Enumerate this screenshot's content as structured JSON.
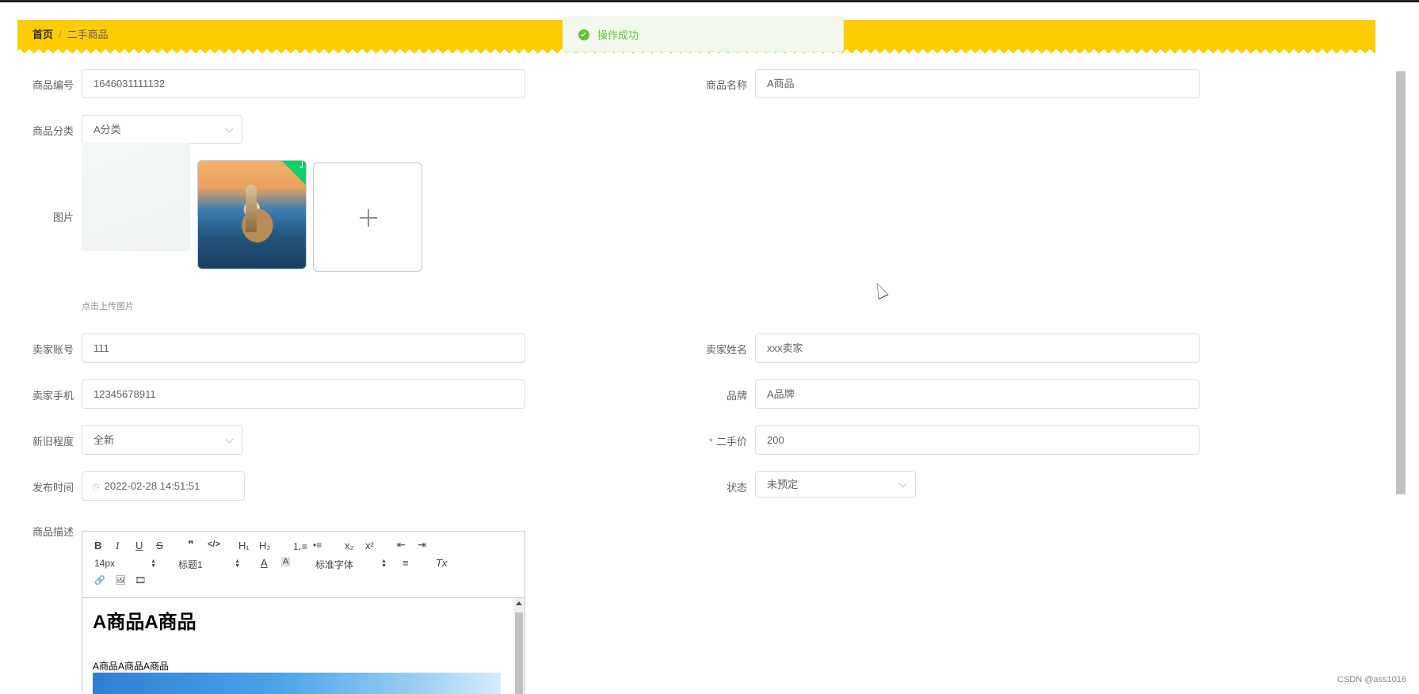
{
  "breadcrumb": {
    "home": "首页",
    "separator": "/",
    "current": "二手商品"
  },
  "toast": {
    "message": "操作成功"
  },
  "form": {
    "product_no": {
      "label": "商品编号",
      "value": "1646031111132"
    },
    "product_name": {
      "label": "商品名称",
      "value": "A商品"
    },
    "category": {
      "label": "商品分类",
      "value": "A分类"
    },
    "image": {
      "label": "图片",
      "hint": "点击上传图片"
    },
    "seller_account": {
      "label": "卖家账号",
      "value": "111"
    },
    "seller_name": {
      "label": "卖家姓名",
      "value": "xxx卖家"
    },
    "seller_phone": {
      "label": "卖家手机",
      "value": "12345678911"
    },
    "brand": {
      "label": "品牌",
      "value": "A品牌"
    },
    "condition": {
      "label": "新旧程度",
      "value": "全新"
    },
    "price": {
      "label": "二手价",
      "required_mark": "*",
      "value": "200"
    },
    "publish_time": {
      "label": "发布时间",
      "value": "2022-02-28 14:51:51"
    },
    "status": {
      "label": "状态",
      "value": "未预定"
    },
    "description": {
      "label": "商品描述"
    }
  },
  "editor": {
    "toolbar": {
      "bold": "B",
      "italic": "I",
      "underline": "U",
      "strike": "S",
      "quote": "❞",
      "code": "</>",
      "h1": "H₁",
      "h2": "H₂",
      "ordered_list": "⒈≡",
      "bullet_list": "•≡",
      "subscript": "x₂",
      "superscript": "x²",
      "outdent": "⇤",
      "indent": "⇥",
      "font_size": "14px",
      "header": "标题1",
      "text_color": "A",
      "bg_color": "A",
      "font_family": "标准字体",
      "align": "≡",
      "clean": "Tx",
      "link": "🔗",
      "image": "🖼",
      "video": "🎞"
    },
    "content_heading": "A商品A商品",
    "content_text": "A商品A商品A商品"
  },
  "watermark": "CSDN @ass1016"
}
